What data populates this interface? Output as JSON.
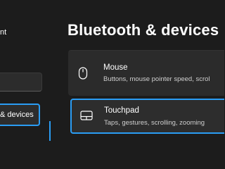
{
  "nav": {
    "user_fragment": "nt",
    "selected_item_label": "& devices"
  },
  "main": {
    "title": "Bluetooth & devices",
    "cards": [
      {
        "title": "Mouse",
        "description": "Buttons, mouse pointer speed, scrol",
        "icon": "mouse-icon"
      },
      {
        "title": "Touchpad",
        "description": "Taps, gestures, scrolling, zooming",
        "icon": "touchpad-icon"
      }
    ]
  },
  "colors": {
    "background": "#1c1c1c",
    "card": "#2b2b2b",
    "accent": "#2a9df4"
  }
}
